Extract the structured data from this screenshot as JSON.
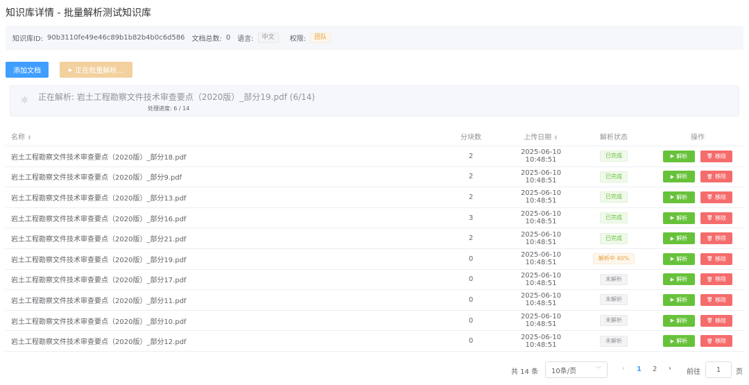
{
  "page_title": "知识库详情 - 批量解析测试知识库",
  "info": {
    "id_label": "知识库ID:",
    "id_value": "90b3110fe49e46c89b1b82b4b0c6d586",
    "count_label": "文档总数:",
    "count_value": "0",
    "lang_label": "语言:",
    "lang_value": "中文",
    "perm_label": "权限:",
    "perm_value": "团队"
  },
  "toolbar": {
    "add_label": "添加文档",
    "batch_label": "正在批量解析..."
  },
  "progress": {
    "current_text": "正在解析: 岩土工程勘察文件技术审查要点（2020版）_部分19.pdf (6/14)",
    "count_text": "处理进度: 6 / 14"
  },
  "table": {
    "headers": {
      "name": "名称",
      "chunks": "分块数",
      "date": "上传日期",
      "status": "解析状态",
      "ops": "操作"
    },
    "parse_label": "解析",
    "remove_label": "移除",
    "rows": [
      {
        "name": "岩土工程勘察文件技术审查要点（2020版）_部分18.pdf",
        "chunks": "2",
        "date": "2025-06-10 10:48:51",
        "status": "已完成",
        "status_type": "done"
      },
      {
        "name": "岩土工程勘察文件技术审查要点（2020版）_部分9.pdf",
        "chunks": "2",
        "date": "2025-06-10 10:48:51",
        "status": "已完成",
        "status_type": "done"
      },
      {
        "name": "岩土工程勘察文件技术审查要点（2020版）_部分13.pdf",
        "chunks": "2",
        "date": "2025-06-10 10:48:51",
        "status": "已完成",
        "status_type": "done"
      },
      {
        "name": "岩土工程勘察文件技术审查要点（2020版）_部分16.pdf",
        "chunks": "3",
        "date": "2025-06-10 10:48:51",
        "status": "已完成",
        "status_type": "done"
      },
      {
        "name": "岩土工程勘察文件技术审查要点（2020版）_部分21.pdf",
        "chunks": "2",
        "date": "2025-06-10 10:48:51",
        "status": "已完成",
        "status_type": "done"
      },
      {
        "name": "岩土工程勘察文件技术审查要点（2020版）_部分19.pdf",
        "chunks": "0",
        "date": "2025-06-10 10:48:51",
        "status": "解析中 40%",
        "status_type": "parsing"
      },
      {
        "name": "岩土工程勘察文件技术审查要点（2020版）_部分17.pdf",
        "chunks": "0",
        "date": "2025-06-10 10:48:51",
        "status": "未解析",
        "status_type": "none"
      },
      {
        "name": "岩土工程勘察文件技术审查要点（2020版）_部分11.pdf",
        "chunks": "0",
        "date": "2025-06-10 10:48:51",
        "status": "未解析",
        "status_type": "none"
      },
      {
        "name": "岩土工程勘察文件技术审查要点（2020版）_部分10.pdf",
        "chunks": "0",
        "date": "2025-06-10 10:48:51",
        "status": "未解析",
        "status_type": "none"
      },
      {
        "name": "岩土工程勘察文件技术审查要点（2020版）_部分12.pdf",
        "chunks": "0",
        "date": "2025-06-10 10:48:51",
        "status": "未解析",
        "status_type": "none"
      }
    ]
  },
  "pagination": {
    "total_text": "共 14 条",
    "page_size": "10条/页",
    "pages": [
      "1",
      "2"
    ],
    "current_page": "1",
    "goto_label": "前往",
    "goto_value": "1",
    "page_unit": "页"
  },
  "colors": {
    "primary": "#409eff",
    "success": "#67c23a",
    "warning": "#e6a23c",
    "danger": "#f56c6c"
  }
}
